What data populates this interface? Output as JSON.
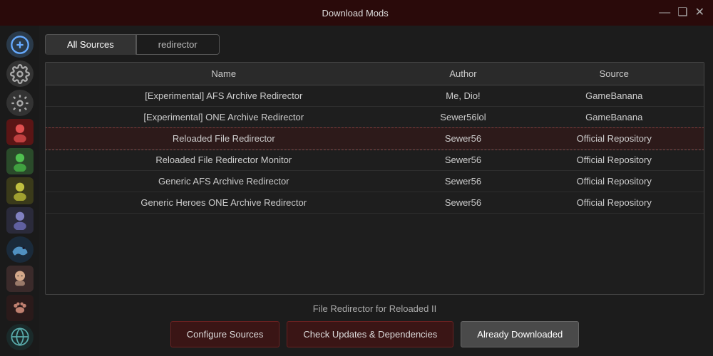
{
  "titlebar": {
    "title": "Download Mods",
    "minimize": "—",
    "maximize": "❑",
    "close": "✕"
  },
  "tabs": [
    {
      "id": "all-sources",
      "label": "All Sources",
      "active": true
    },
    {
      "id": "redirector",
      "label": "redirector",
      "active": false
    }
  ],
  "table": {
    "headers": [
      "Name",
      "Author",
      "Source"
    ],
    "rows": [
      {
        "name": "[Experimental] AFS Archive Redirector",
        "author": "Me, Dio!",
        "source": "GameBanana",
        "selected": false
      },
      {
        "name": "[Experimental] ONE Archive Redirector",
        "author": "Sewer56lol",
        "source": "GameBanana",
        "selected": false
      },
      {
        "name": "Reloaded File Redirector",
        "author": "Sewer56",
        "source": "Official Repository",
        "selected": true
      },
      {
        "name": "Reloaded File Redirector Monitor",
        "author": "Sewer56",
        "source": "Official Repository",
        "selected": false
      },
      {
        "name": "Generic AFS Archive Redirector",
        "author": "Sewer56",
        "source": "Official Repository",
        "selected": false
      },
      {
        "name": "Generic Heroes ONE Archive Redirector",
        "author": "Sewer56",
        "source": "Official Repository",
        "selected": false
      }
    ]
  },
  "subtitle": "File Redirector for Reloaded II",
  "buttons": {
    "configure": "Configure Sources",
    "check_updates": "Check Updates & Dependencies",
    "already_downloaded": "Already Downloaded"
  },
  "sidebar": {
    "icons": [
      {
        "id": "add-circle",
        "symbol": "⊕",
        "class": "icon-add"
      },
      {
        "id": "gear",
        "symbol": "⚙",
        "class": "icon-gear"
      },
      {
        "id": "settings2",
        "symbol": "⚙",
        "class": "icon-settings2"
      },
      {
        "id": "red-char",
        "symbol": "🎭",
        "class": "icon-red"
      },
      {
        "id": "green-char",
        "symbol": "👾",
        "class": "icon-green"
      },
      {
        "id": "yellow-char",
        "symbol": "🧩",
        "class": "icon-yellow"
      },
      {
        "id": "char2",
        "symbol": "🕹",
        "class": "icon-char"
      },
      {
        "id": "dolphin",
        "symbol": "🐬",
        "class": "icon-dolphin"
      },
      {
        "id": "anime",
        "symbol": "🧑",
        "class": "icon-anime"
      },
      {
        "id": "paw",
        "symbol": "🐾",
        "class": "icon-paw"
      },
      {
        "id": "globe",
        "symbol": "🌐",
        "class": "icon-globe"
      }
    ]
  }
}
